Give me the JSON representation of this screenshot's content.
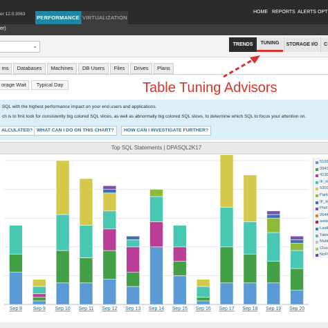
{
  "topnav": {
    "version_text": "er  12.0.3063",
    "tabs": [
      "PERFORMANCE",
      "VIRTUALIZATION"
    ],
    "links": [
      "HOME",
      "REPORTS",
      "ALERTS",
      "OPT"
    ]
  },
  "subnav": {
    "selector_text": "er)"
  },
  "right_tabs": [
    "TRENDS",
    "TUNING",
    "STORAGE I/O",
    "C"
  ],
  "dim_tabs": [
    "ms",
    "Databases",
    "Machines",
    "DB Users",
    "Files",
    "Drives",
    "Plans"
  ],
  "period_tabs": [
    "orage Wait",
    "Typical Day"
  ],
  "callout": {
    "text": "Table Tuning Advisors",
    "color": "#d8332a"
  },
  "info": {
    "line1": "SQL with the highest performance impact on your end users and applications.",
    "line2": "ch is to first look for consistently big colored SQL slices, as well as abnormally big colored SQL slices, to determine which SQL to focus your attention on.",
    "questions": [
      "ALCULATED?",
      "WHAT CAN I DO ON THIS CHART?",
      "HOW CAN I INVESTIGATE FURTHER?"
    ]
  },
  "chart_data": {
    "type": "bar",
    "stacked": true,
    "title": "Top SQL Statements   |   DPASQL2K17",
    "categories": [
      "Sep 8",
      "Sep 9",
      "Sep 10",
      "Sep 11",
      "Sep 12",
      "Sep 13",
      "Sep 14",
      "Sep 15",
      "Sep 16",
      "Sep 17",
      "Sep 18",
      "Sep 19",
      "Sep 20"
    ],
    "grid": true,
    "legend_placement": "right",
    "series": [
      {
        "name": "5191",
        "color": "#5b9bd5",
        "values": [
          45,
          5,
          30,
          30,
          35,
          25,
          80,
          40,
          5,
          30,
          30,
          30,
          20
        ]
      },
      {
        "name": "3943",
        "color": "#43a047",
        "values": [
          25,
          5,
          45,
          35,
          40,
          20,
          0,
          20,
          5,
          50,
          40,
          30,
          30
        ]
      },
      {
        "name": "4130",
        "color": "#ba3d98",
        "values": [
          0,
          5,
          0,
          0,
          30,
          35,
          35,
          20,
          0,
          0,
          0,
          0,
          0
        ]
      },
      {
        "name": "IF_H",
        "color": "#48c7b3",
        "values": [
          40,
          10,
          50,
          45,
          25,
          10,
          35,
          30,
          15,
          55,
          45,
          40,
          25
        ]
      },
      {
        "name": "5303",
        "color": "#d4c94a",
        "values": [
          0,
          10,
          75,
          65,
          25,
          0,
          0,
          0,
          10,
          75,
          65,
          0,
          0
        ]
      },
      {
        "name": "Partit",
        "color": "#8eba3c",
        "values": [
          0,
          0,
          0,
          0,
          0,
          0,
          10,
          0,
          0,
          0,
          0,
          20,
          10
        ]
      },
      {
        "name": "IF_H",
        "color": "#3f6fb3",
        "values": [
          0,
          0,
          0,
          0,
          5,
          5,
          0,
          0,
          0,
          0,
          0,
          5,
          5
        ]
      },
      {
        "name": "PhiF",
        "color": "#7b4fb0",
        "values": [
          0,
          0,
          0,
          0,
          5,
          0,
          0,
          0,
          0,
          0,
          0,
          5,
          5
        ]
      },
      {
        "name": "2644",
        "color": "#e97b2c",
        "values": [
          0,
          0,
          0,
          0,
          0,
          0,
          0,
          0,
          0,
          0,
          0,
          0,
          0
        ]
      },
      {
        "name": "aside",
        "color": "#a7283f",
        "values": [
          0,
          0,
          0,
          0,
          0,
          0,
          0,
          0,
          0,
          0,
          0,
          0,
          0
        ]
      },
      {
        "name": "Lastl",
        "color": "#2e8bc0",
        "values": [
          0,
          0,
          0,
          0,
          0,
          0,
          0,
          0,
          0,
          0,
          0,
          0,
          0
        ]
      },
      {
        "name": "Table",
        "color": "#5fb8cf",
        "values": [
          0,
          0,
          0,
          0,
          0,
          0,
          0,
          0,
          0,
          0,
          0,
          0,
          0
        ]
      },
      {
        "name": "Multi",
        "color": "#c2c2c2",
        "values": [
          0,
          0,
          0,
          0,
          0,
          0,
          0,
          0,
          0,
          0,
          0,
          0,
          0
        ]
      },
      {
        "name": "Clust",
        "color": "#9ccc65",
        "values": [
          0,
          0,
          0,
          0,
          0,
          0,
          0,
          0,
          0,
          0,
          0,
          0,
          0
        ]
      },
      {
        "name": "NoPe",
        "color": "#5c4fb3",
        "values": [
          0,
          0,
          0,
          0,
          0,
          0,
          0,
          0,
          0,
          0,
          0,
          0,
          0
        ]
      }
    ],
    "ylim": [
      0,
      200
    ]
  }
}
